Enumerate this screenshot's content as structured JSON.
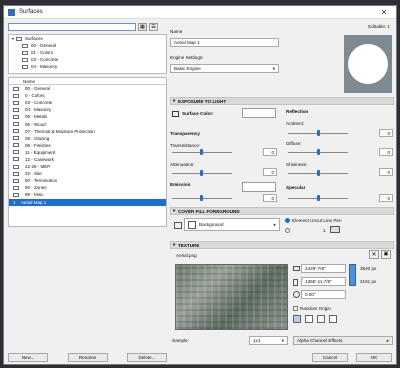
{
  "window": {
    "title": "Surfaces"
  },
  "search": {
    "value": ""
  },
  "tree": [
    {
      "label": "Surfaces"
    },
    {
      "label": "00 - General"
    },
    {
      "label": "01 - Colors"
    },
    {
      "label": "03 - Concrete"
    },
    {
      "label": "04 - Masonry"
    }
  ],
  "list": {
    "header": "Name",
    "items": [
      "00 - General",
      "0 - Colors",
      "03 - Concrete",
      "04 - Masonry",
      "05 - Metals",
      "06 - Wood",
      "07 - Thermal & Moisture Protection",
      "08 - Glazing",
      "09 - Finishes",
      "11 - Equipment",
      "12 - Casework",
      "22-26 - MEP",
      "32 - Site",
      "50 - Terminotion",
      "90 - Zones",
      "99 - Misc."
    ],
    "selected": {
      "num": "1",
      "label": "Aerial Map 1"
    }
  },
  "left_buttons": {
    "new": "New...",
    "rename": "Rename",
    "delete": "Delete..."
  },
  "details": {
    "name_label": "Name",
    "editable": "Editable: 1",
    "name_value": "Aerial Map 1",
    "engine_label": "Engine Settings:",
    "engine_value": "Basic Engine"
  },
  "exposure": {
    "title": "EXPOSURE TO LIGHT",
    "surface_color": "Surface Color:",
    "reflection": "Reflection",
    "ambient": "Ambient:",
    "diffuse": "Diffuse:",
    "shininess": "Shininess:",
    "specular": "Specular",
    "transparency": "Transparency",
    "transmittance": "Transmittance:",
    "attenuation": "Attenuation:",
    "emission": "Emission",
    "values": {
      "ambient": "0",
      "diffuse": "0",
      "shininess": "0",
      "specular": "0",
      "transmittance": "0",
      "attenuation": "0",
      "emission": "0"
    }
  },
  "cover": {
    "title": "COVER FILL FOREGROUND",
    "fill": "Background",
    "pen_option": "Element Uncut Line Pen",
    "pen_num": "1"
  },
  "texture": {
    "title": "TEXTURE",
    "file": "Aerial.png",
    "width": "2429'-7/8\"",
    "height": "1366'-11 7/8\"",
    "px_w": "3840 px",
    "px_h": "2161 px",
    "angle": "0.00°",
    "random_origin": "Random Origin",
    "sample_label": "Sample:",
    "sample_value": "1x1",
    "alpha": "Alpha Channel Effects"
  },
  "footer": {
    "cancel": "Cancel",
    "ok": "OK"
  }
}
